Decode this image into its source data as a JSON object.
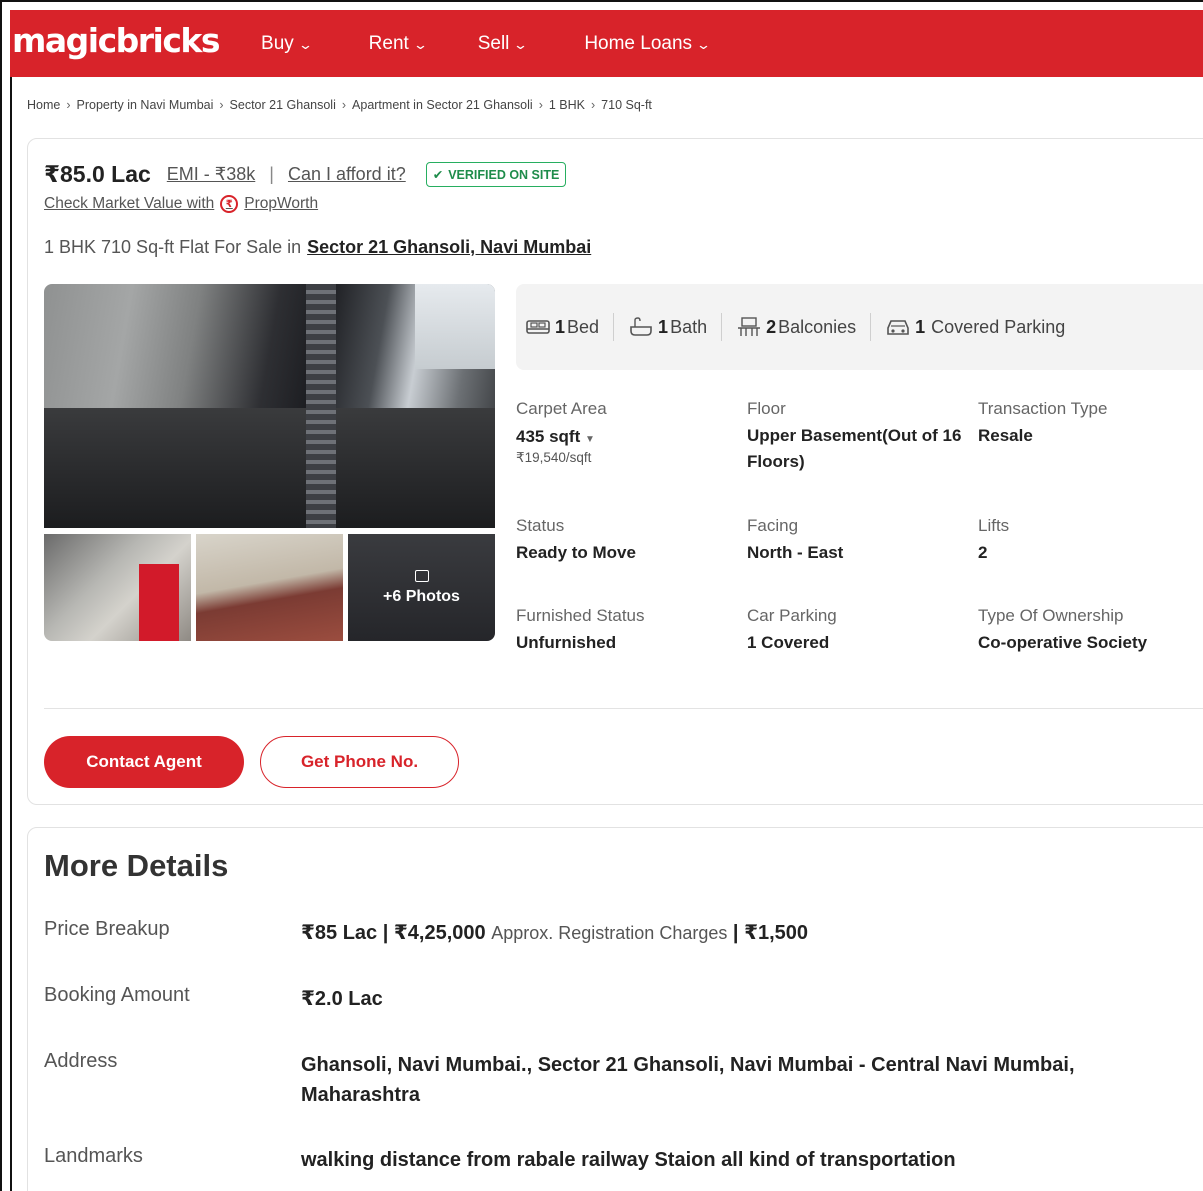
{
  "header": {
    "logo": "magicbricks",
    "nav": [
      {
        "label": "Buy"
      },
      {
        "label": "Rent"
      },
      {
        "label": "Sell"
      },
      {
        "label": "Home Loans"
      }
    ]
  },
  "breadcrumb": [
    "Home",
    "Property in Navi Mumbai",
    "Sector 21 Ghansoli",
    "Apartment in Sector 21 Ghansoli",
    "1 BHK",
    "710 Sq-ft"
  ],
  "listing": {
    "price": "₹85.0 Lac",
    "emi": "EMI - ₹38k",
    "afford": "Can I afford it?",
    "verified": "VERIFIED ON SITE",
    "check_market": "Check Market Value with",
    "propworth": "PropWorth",
    "headline": "1 BHK 710 Sq-ft Flat For Sale in",
    "location": "Sector 21 Ghansoli, Navi Mumbai",
    "photos_more": "+6 Photos",
    "amenities": [
      {
        "count": "1",
        "label": "Bed",
        "icon": "bed-icon"
      },
      {
        "count": "1",
        "label": "Bath",
        "icon": "bath-icon"
      },
      {
        "count": "2",
        "label": "Balconies",
        "icon": "balcony-icon"
      },
      {
        "count": "1",
        "label": "Covered Parking",
        "icon": "car-icon"
      }
    ],
    "summary": {
      "carpet_area": {
        "label": "Carpet Area",
        "value": "435 sqft",
        "sub": "₹19,540/sqft"
      },
      "floor": {
        "label": "Floor",
        "value": "Upper Basement(Out of 16 Floors)"
      },
      "transaction": {
        "label": "Transaction Type",
        "value": "Resale"
      },
      "status": {
        "label": "Status",
        "value": "Ready to Move"
      },
      "facing": {
        "label": "Facing",
        "value": "North - East"
      },
      "lifts": {
        "label": "Lifts",
        "value": "2"
      },
      "furnished": {
        "label": "Furnished Status",
        "value": "Unfurnished"
      },
      "car_parking": {
        "label": "Car Parking",
        "value": "1 Covered"
      },
      "ownership": {
        "label": "Type Of Ownership",
        "value": "Co-operative Society"
      }
    },
    "buttons": {
      "contact": "Contact Agent",
      "phone": "Get Phone No."
    }
  },
  "more_details": {
    "title": "More Details",
    "price_breakup": {
      "label": "Price Breakup",
      "value": "₹85 Lac | ₹4,25,000",
      "note": "Approx. Registration Charges",
      "extra": "| ₹1,500"
    },
    "booking": {
      "label": "Booking Amount",
      "value": "₹2.0 Lac"
    },
    "address": {
      "label": "Address",
      "value": "Ghansoli, Navi Mumbai., Sector 21 Ghansoli, Navi Mumbai - Central Navi Mumbai, Maharashtra"
    },
    "landmarks": {
      "label": "Landmarks",
      "value": "walking distance from rabale railway Staion all kind of transportation"
    }
  },
  "colors": {
    "brand": "#d8232a",
    "verified": "#1e8c4a"
  }
}
